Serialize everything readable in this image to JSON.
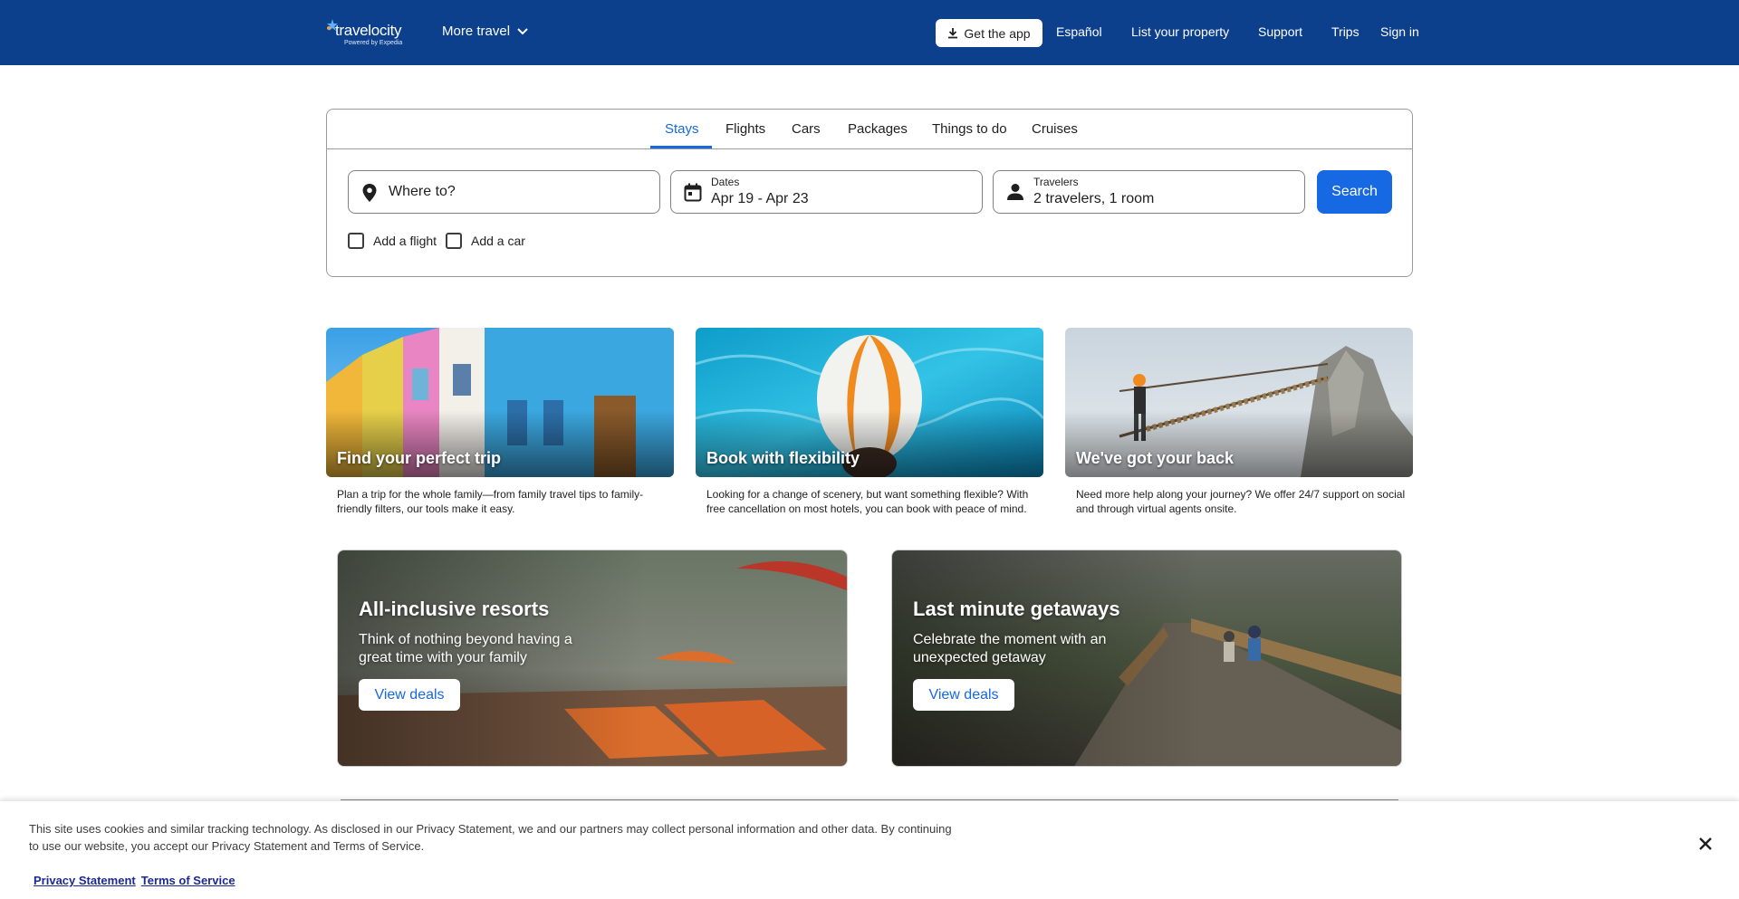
{
  "header": {
    "logo_text": "travelocity",
    "logo_sub": "Powered by Expedia",
    "more_travel": "More travel",
    "get_app": "Get the app",
    "links": [
      "Español",
      "List your property",
      "Support",
      "Trips",
      "Sign in"
    ]
  },
  "search": {
    "tabs": [
      "Stays",
      "Flights",
      "Cars",
      "Packages",
      "Things to do",
      "Cruises"
    ],
    "active_tab": "Stays",
    "destination_placeholder": "Where to?",
    "dates_label": "Dates",
    "dates_value": "Apr 19 - Apr 23",
    "travelers_label": "Travelers",
    "travelers_value": "2 travelers, 1 room",
    "search_button": "Search",
    "add_flight": "Add a flight",
    "add_car": "Add a car"
  },
  "promos": [
    {
      "title": "Find your perfect trip",
      "desc": "Plan a trip for the whole family—from family travel tips to family-friendly filters, our tools make it easy."
    },
    {
      "title": "Book with flexibility",
      "desc": "Looking for a change of scenery, but want something flexible? With free cancellation on most hotels, you can book with peace of mind."
    },
    {
      "title": "We've got your back",
      "desc": "Need more help along your journey? We offer 24/7 support on social and through virtual agents onsite."
    }
  ],
  "banners": [
    {
      "title": "All-inclusive resorts",
      "desc": "Think of nothing beyond having a great time with your family",
      "button": "View deals"
    },
    {
      "title": "Last minute getaways",
      "desc": "Celebrate the moment with an unexpected getaway",
      "button": "View deals"
    }
  ],
  "cookie": {
    "text": "This site uses cookies and similar tracking technology. As disclosed in our Privacy Statement, we and our partners may collect personal information and other data. By continuing to use our website, you accept our Privacy Statement and Terms of Service.",
    "privacy_link": "Privacy Statement",
    "terms_link": "Terms of Service"
  },
  "colors": {
    "header_bg": "#0c3f8c",
    "accent": "#1668e3"
  }
}
